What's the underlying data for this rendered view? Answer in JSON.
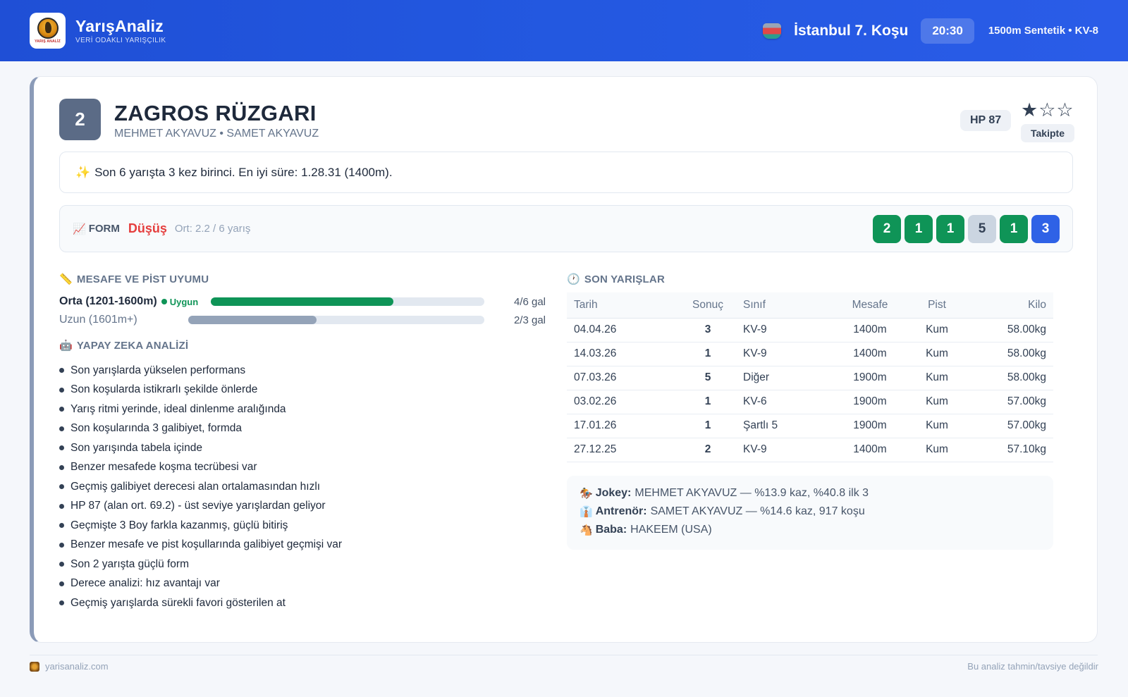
{
  "header": {
    "brand_title": "YarışAnaliz",
    "brand_subtitle": "VERİ ODAKLI YARIŞÇILIK",
    "logo_text": "YARIŞ ANALİZ",
    "race_title": "İstanbul 7. Koşu",
    "race_time": "20:30",
    "race_meta": "1500m Sentetik • KV-8",
    "silk_icon": "jockey-silk-icon"
  },
  "horse": {
    "number": "2",
    "name": "ZAGROS RÜZGARI",
    "people": "MEHMET AKYAVUZ • SAMET AKYAVUZ",
    "hp": "HP 87",
    "stars": "★☆☆",
    "rating_stars": 1,
    "follow_label": "Takipte"
  },
  "highlight": {
    "icon": "✨",
    "text": "Son 6 yarışta 3 kez birinci. En iyi süre: 1.28.31 (1400m)."
  },
  "form": {
    "icon": "📈",
    "label": "FORM",
    "trend": "Düşüş",
    "average": "Ort: 2.2 / 6 yarış",
    "badges": [
      {
        "value": "2",
        "kind": "win"
      },
      {
        "value": "1",
        "kind": "win"
      },
      {
        "value": "1",
        "kind": "win"
      },
      {
        "value": "5",
        "kind": "mid"
      },
      {
        "value": "1",
        "kind": "win"
      },
      {
        "value": "3",
        "kind": "place"
      }
    ]
  },
  "distance": {
    "icon": "📏",
    "title": "MESAFE VE PİST UYUMU",
    "rows": [
      {
        "label": "Orta (1201-1600m)",
        "tag": "Uygun",
        "value": "4/6 gal",
        "ratio": 0.6667,
        "color": "#0f9457"
      },
      {
        "label": "Uzun (1601m+)",
        "tag": "",
        "value": "2/3 gal",
        "ratio": 0.4333,
        "color": "#94a3b8"
      }
    ]
  },
  "ai": {
    "icon": "🤖",
    "title": "YAPAY ZEKA ANALİZİ",
    "items": [
      "Son yarışlarda yükselen performans",
      "Son koşularda istikrarlı şekilde önlerde",
      "Yarış ritmi yerinde, ideal dinlenme aralığında",
      "Son koşularında 3 galibiyet, formda",
      "Son yarışında tabela içinde",
      "Benzer mesafede koşma tecrübesi var",
      "Geçmiş galibiyet derecesi alan ortalamasından hızlı",
      "HP 87 (alan ort. 69.2) - üst seviye yarışlardan geliyor",
      "Geçmişte 3 Boy farkla kazanmış, güçlü bitiriş",
      "Benzer mesafe ve pist koşullarında galibiyet geçmişi var",
      "Son 2 yarışta güçlü form",
      "Derece analizi: hız avantajı var",
      "Geçmiş yarışlarda sürekli favori gösterilen at"
    ]
  },
  "races": {
    "icon": "🕐",
    "title": "SON YARIŞLAR",
    "headers": [
      "Tarih",
      "Sonuç",
      "Sınıf",
      "Mesafe",
      "Pist",
      "Kilo"
    ],
    "rows": [
      [
        "04.04.26",
        "3",
        "KV-9",
        "1400m",
        "Kum",
        "58.00kg"
      ],
      [
        "14.03.26",
        "1",
        "KV-9",
        "1400m",
        "Kum",
        "58.00kg"
      ],
      [
        "07.03.26",
        "5",
        "Diğer",
        "1900m",
        "Kum",
        "58.00kg"
      ],
      [
        "03.02.26",
        "1",
        "KV-6",
        "1900m",
        "Kum",
        "57.00kg"
      ],
      [
        "17.01.26",
        "1",
        "Şartlı 5",
        "1900m",
        "Kum",
        "57.00kg"
      ],
      [
        "27.12.25",
        "2",
        "KV-9",
        "1400m",
        "Kum",
        "57.10kg"
      ]
    ]
  },
  "info": {
    "jockey_icon": "🏇",
    "jockey_label": "Jokey:",
    "jockey_text": "MEHMET AKYAVUZ — %13.9 kaz, %40.8 ilk 3",
    "trainer_icon": "👔",
    "trainer_label": "Antrenör:",
    "trainer_text": "SAMET AKYAVUZ — %14.6 kaz, 917 koşu",
    "sire_icon": "🐴",
    "sire_label": "Baba:",
    "sire_text": "HAKEEM (USA)"
  },
  "footer": {
    "site": "yarisanaliz.com",
    "disclaimer": "Bu analiz tahmin/tavsiye değildir"
  }
}
